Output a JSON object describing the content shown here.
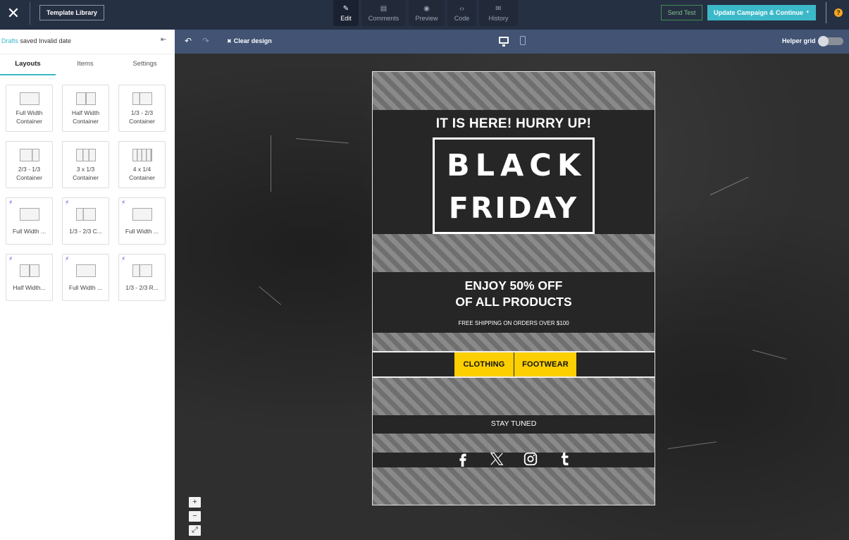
{
  "topbar": {
    "close_icon": "close-icon",
    "template_library": "Template Library",
    "tabs": [
      {
        "label": "Edit",
        "icon": "pencil-icon",
        "glyph": "✎",
        "active": true
      },
      {
        "label": "Comments",
        "icon": "comments-icon",
        "glyph": "▤",
        "active": false
      },
      {
        "label": "Preview",
        "icon": "eye-icon",
        "glyph": "◉",
        "active": false
      },
      {
        "label": "Code",
        "icon": "code-icon",
        "glyph": "‹›",
        "active": false
      },
      {
        "label": "History",
        "icon": "history-icon",
        "glyph": "✉",
        "active": false
      }
    ],
    "send_test": "Send Test",
    "update_campaign": "Update Campaign & Continue",
    "update_caret": "▾",
    "help_glyph": "?",
    "colors": {
      "accent": "#3cb9c9",
      "send_test": "#3f8e4f",
      "help": "#f5a623"
    }
  },
  "sidebar": {
    "status_drafts": "Drafts",
    "status_text": " saved Invalid date",
    "collapse_glyph": "⇤",
    "tabs": [
      {
        "label": "Layouts",
        "active": true
      },
      {
        "label": "Items",
        "active": false
      },
      {
        "label": "Settings",
        "active": false
      }
    ],
    "layouts": [
      {
        "label": "Full Width\nContainer",
        "pro": false
      },
      {
        "label": "Half Width\nContainer",
        "pro": false
      },
      {
        "label": "1/3 - 2/3\nContainer",
        "pro": false
      },
      {
        "label": "2/3 - 1/3\nContainer",
        "pro": false
      },
      {
        "label": "3 x 1/3\nContainer",
        "pro": false
      },
      {
        "label": "4 x 1/4\nContainer",
        "pro": false
      },
      {
        "label": "Full Width ...",
        "pro": true
      },
      {
        "label": "1/3 - 2/3 C...",
        "pro": true
      },
      {
        "label": "Full Width ...",
        "pro": true
      },
      {
        "label": "Half Width...",
        "pro": true
      },
      {
        "label": "Full Width ...",
        "pro": true
      },
      {
        "label": "1/3 - 2/3 R...",
        "pro": true
      }
    ],
    "pro_glyph": "⚡"
  },
  "toolbar": {
    "undo_glyph": "↶",
    "redo_glyph": "↷",
    "clear_design": "Clear design",
    "clear_glyph": "✖",
    "helper_grid": "Helper grid",
    "helper_grid_on": false,
    "active_device": "desktop"
  },
  "zoom_controls": {
    "zoom_in": "+",
    "zoom_out": "−",
    "fit": "⤢"
  },
  "email": {
    "hurry": "IT IS HERE! HURRY UP!",
    "headline_1": "BLACK",
    "headline_2": "FRIDAY",
    "offer_1": "ENJOY 50% OFF",
    "offer_2": "OF ALL PRODUCTS",
    "free_shipping": "FREE SHIPPING ON ORDERS OVER $100",
    "categories": [
      "CLOTHING",
      "FOOTWEAR"
    ],
    "stay_tuned": "STAY TUNED",
    "social": [
      "facebook",
      "x",
      "instagram",
      "tumblr"
    ],
    "colors": {
      "category_button": "#fccf00",
      "background": "#262626"
    }
  }
}
